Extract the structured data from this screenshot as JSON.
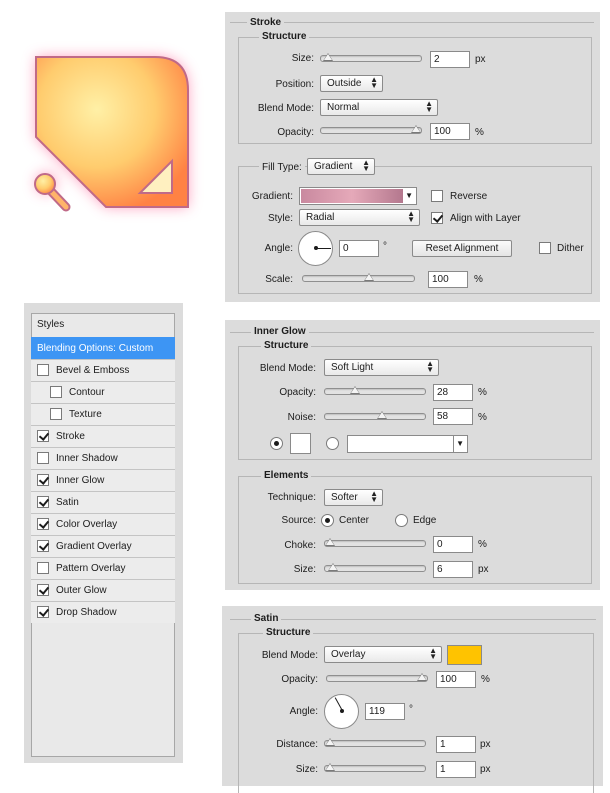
{
  "stroke": {
    "title": "Stroke",
    "structure": "Structure",
    "size_label": "Size:",
    "size_value": "2",
    "size_unit": "px",
    "size_level": 0.02,
    "position_label": "Position:",
    "position_value": "Outside",
    "blend_label": "Blend Mode:",
    "blend_value": "Normal",
    "opacity_label": "Opacity:",
    "opacity_value": "100",
    "opacity_unit": "%",
    "opacity_level": 1.0,
    "fill_type_label": "Fill Type:",
    "fill_type_value": "Gradient",
    "gradient_label": "Gradient:",
    "gradient_colors": [
      "#c9899f",
      "#e5a9b9",
      "#b4788e"
    ],
    "reverse_label": "Reverse",
    "reverse_checked": false,
    "style_label": "Style:",
    "style_value": "Radial",
    "align_label": "Align with Layer",
    "align_checked": true,
    "angle_label": "Angle:",
    "angle_value": "0",
    "angle_unit": "°",
    "reset_label": "Reset Alignment",
    "dither_label": "Dither",
    "dither_checked": false,
    "scale_label": "Scale:",
    "scale_value": "100",
    "scale_unit": "%",
    "scale_level": 0.6
  },
  "styles": {
    "header": "Styles",
    "selected": "Blending Options: Custom",
    "items": [
      {
        "label": "Bevel & Emboss",
        "checked": false
      },
      {
        "label": "Contour",
        "checked": false
      },
      {
        "label": "Texture",
        "checked": false
      },
      {
        "label": "Stroke",
        "checked": true
      },
      {
        "label": "Inner Shadow",
        "checked": false
      },
      {
        "label": "Inner Glow",
        "checked": true
      },
      {
        "label": "Satin",
        "checked": true
      },
      {
        "label": "Color Overlay",
        "checked": true
      },
      {
        "label": "Gradient Overlay",
        "checked": true
      },
      {
        "label": "Pattern Overlay",
        "checked": false
      },
      {
        "label": "Outer Glow",
        "checked": true
      },
      {
        "label": "Drop Shadow",
        "checked": true
      }
    ]
  },
  "inner_glow": {
    "title": "Inner Glow",
    "structure": "Structure",
    "blend_label": "Blend Mode:",
    "blend_value": "Soft Light",
    "opacity_label": "Opacity:",
    "opacity_value": "28",
    "opacity_unit": "%",
    "opacity_level": 0.28,
    "noise_label": "Noise:",
    "noise_value": "58",
    "noise_unit": "%",
    "noise_level": 0.58,
    "color": "#ffffff",
    "elements": "Elements",
    "technique_label": "Technique:",
    "technique_value": "Softer",
    "source_label": "Source:",
    "center_label": "Center",
    "edge_label": "Edge",
    "choke_label": "Choke:",
    "choke_value": "0",
    "choke_unit": "%",
    "choke_level": 0.0,
    "size_label": "Size:",
    "size_value": "6",
    "size_unit": "px",
    "size_level": 0.03
  },
  "satin": {
    "title": "Satin",
    "structure": "Structure",
    "blend_label": "Blend Mode:",
    "blend_value": "Overlay",
    "color": "#ffc300",
    "opacity_label": "Opacity:",
    "opacity_value": "100",
    "opacity_unit": "%",
    "opacity_level": 1.0,
    "angle_label": "Angle:",
    "angle_value": "119",
    "angle_unit": "°",
    "distance_label": "Distance:",
    "distance_value": "1",
    "distance_unit": "px",
    "distance_level": 0.0,
    "size_label": "Size:",
    "size_value": "1",
    "size_unit": "px",
    "size_level": 0.0
  },
  "preview": {
    "fill_color": "#ffd27a",
    "edge_color": "#ff8a4c",
    "stroke_color": "#c06a88",
    "glow_color": "#ff5a8a"
  }
}
